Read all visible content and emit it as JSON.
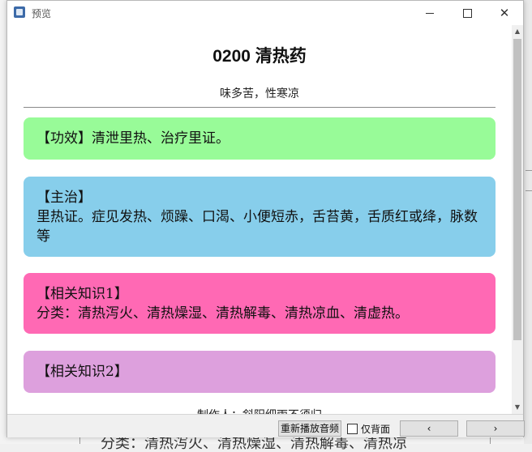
{
  "window": {
    "title": "预览"
  },
  "page": {
    "heading": "0200 清热药",
    "subheading": "味多苦，性寒凉"
  },
  "cards": {
    "efficacy": {
      "title": "【功效】清泄里热、治疗里证。",
      "color": "#98fb98"
    },
    "indication": {
      "title": "【主治】",
      "body": "里热证。症见发热、烦躁、口渴、小便短赤，舌苔黄，舌质红或绛，脉数等",
      "color": "#87ceeb"
    },
    "knowledge1": {
      "title": "【相关知识1】",
      "body": "分类：清热泻火、清热燥湿、清热解毒、清热凉血、清虚热。",
      "color": "#ff69b4"
    },
    "knowledge2": {
      "title": "【相关知识2】",
      "color": "#dda0dd"
    }
  },
  "footer": {
    "text": "制作人：斜阳细雨不须归"
  },
  "toolbar": {
    "replay_label": "重新播放音频",
    "back_only_label": "仅背面",
    "prev_label": "‹",
    "next_label": "›"
  },
  "background": {
    "partial_text": "分类：清热泻火、清热燥湿、清热解毒、清热凉"
  }
}
